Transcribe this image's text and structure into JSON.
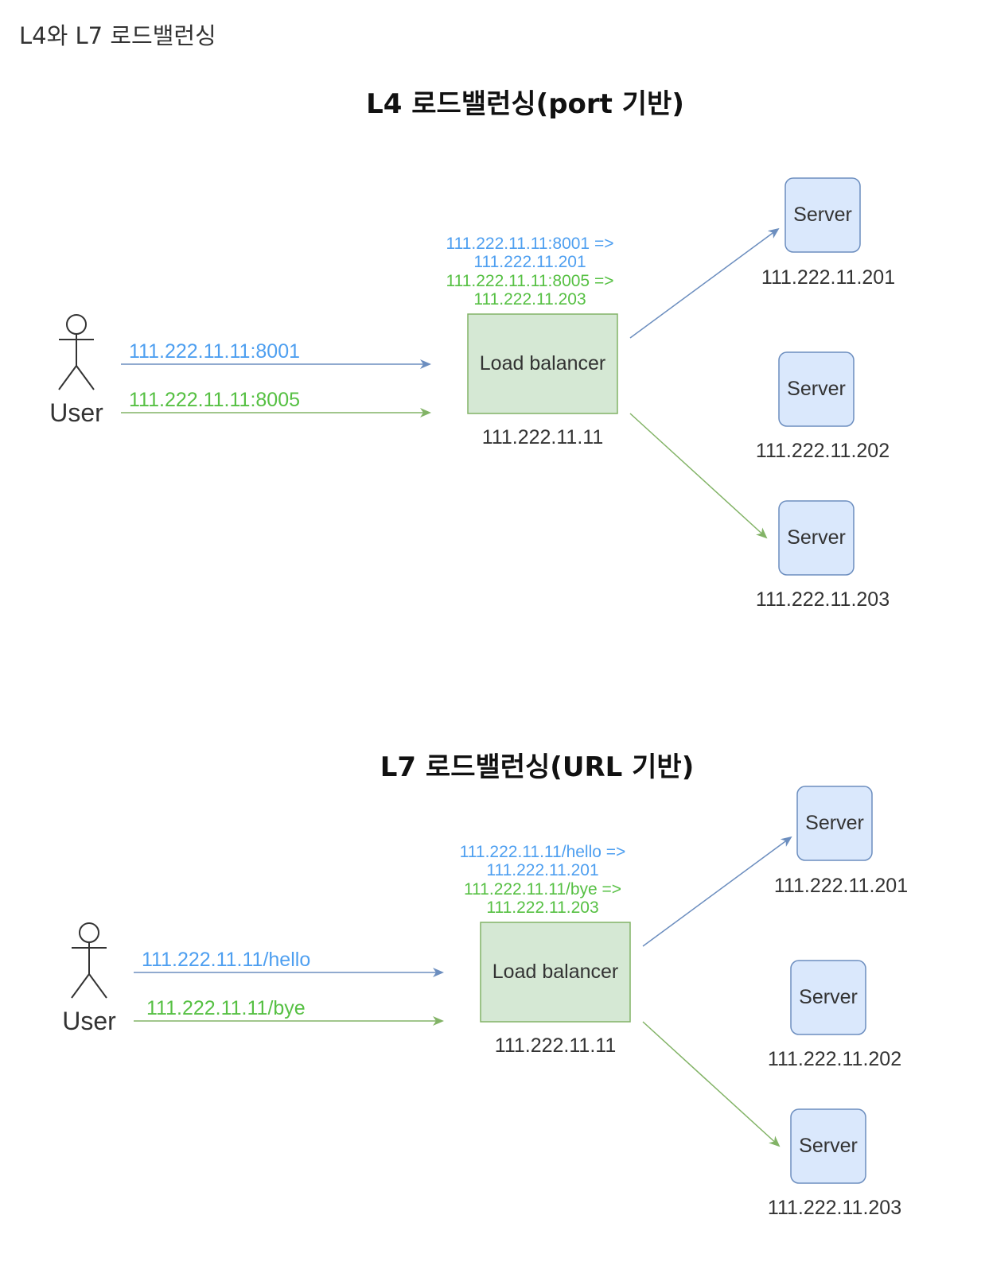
{
  "page_heading": "L4와 L7 로드밸런싱",
  "diagrams": [
    {
      "title": "L4 로드밸런싱(port 기반)",
      "user_label": "User",
      "request1": "111.222.11.11:8001",
      "request2": "111.222.11.11:8005",
      "rule1_from": "111.222.11.11:8001 =>",
      "rule1_to": "111.222.11.201",
      "rule2_from": "111.222.11.11:8005 =>",
      "rule2_to": "111.222.11.203",
      "lb_label": "Load balancer",
      "lb_ip": "111.222.11.11",
      "servers": [
        {
          "label": "Server",
          "ip": "111.222.11.201"
        },
        {
          "label": "Server",
          "ip": "111.222.11.202"
        },
        {
          "label": "Server",
          "ip": "111.222.11.203"
        }
      ]
    },
    {
      "title": "L7 로드밸런싱(URL 기반)",
      "user_label": "User",
      "request1": "111.222.11.11/hello",
      "request2": "111.222.11.11/bye",
      "rule1_from": "111.222.11.11/hello =>",
      "rule1_to": "111.222.11.201",
      "rule2_from": "111.222.11.11/bye =>",
      "rule2_to": "111.222.11.203",
      "lb_label": "Load balancer",
      "lb_ip": "111.222.11.11",
      "servers": [
        {
          "label": "Server",
          "ip": "111.222.11.201"
        },
        {
          "label": "Server",
          "ip": "111.222.11.202"
        },
        {
          "label": "Server",
          "ip": "111.222.11.203"
        }
      ]
    }
  ],
  "colors": {
    "blue_line": "#6c8ebf",
    "green_line": "#82b366",
    "blue_text": "#4e9ff0",
    "green_text": "#56c043",
    "lb_fill": "#d5e8d4",
    "lb_stroke": "#82b366",
    "server_fill": "#dae8fc",
    "server_stroke": "#6c8ebf"
  }
}
